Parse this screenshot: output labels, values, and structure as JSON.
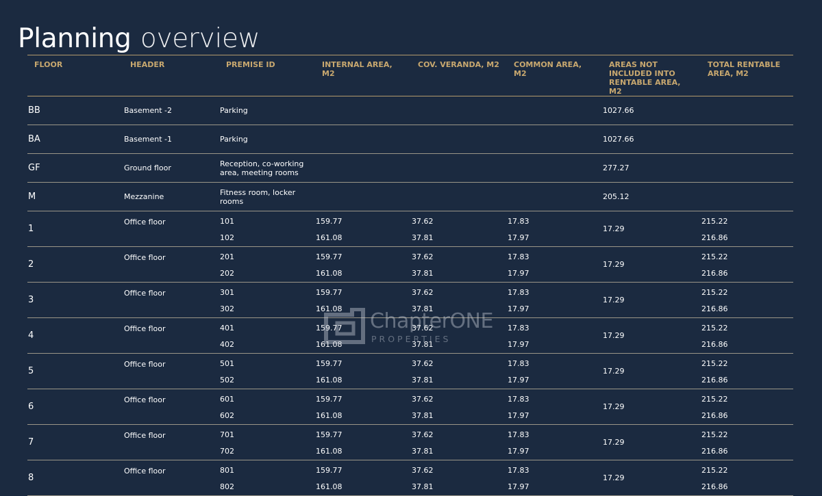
{
  "page": {
    "title_part1": "Planning",
    "title_part2": "overview"
  },
  "table": {
    "headers": [
      "FLOOR",
      "HEADER",
      "PREMISE ID",
      "INTERNAL AREA, m2",
      "COV. VERANDA, m2",
      "COMMON AREA, m2",
      "AREAS NOT INCLUDED INTO RENTABLE AREA, m2",
      "TOTAL RENTABLE AREA, m2"
    ],
    "single_rows": [
      {
        "floor": "BB",
        "header": "Basement -2",
        "premise": "Parking",
        "not_included": "1027.66"
      },
      {
        "floor": "BA",
        "header": "Basement -1",
        "premise": "Parking",
        "not_included": "1027.66"
      },
      {
        "floor": "GF",
        "header": "Ground floor",
        "premise": "Reception, co-working area, meeting rooms",
        "not_included": "277.27"
      },
      {
        "floor": "M",
        "header": "Mezzanine",
        "premise": "Fitness room, locker rooms",
        "not_included": "205.12"
      }
    ],
    "office_rows": [
      {
        "floor": "1",
        "header": "Office floor",
        "ids": [
          "101",
          "102"
        ],
        "internal": [
          "159.77",
          "161.08"
        ],
        "veranda": [
          "37.62",
          "37.81"
        ],
        "common": [
          "17.83",
          "17.97"
        ],
        "not_included": "17.29",
        "total": [
          "215.22",
          "216.86"
        ]
      },
      {
        "floor": "2",
        "header": "Office floor",
        "ids": [
          "201",
          "202"
        ],
        "internal": [
          "159.77",
          "161.08"
        ],
        "veranda": [
          "37.62",
          "37.81"
        ],
        "common": [
          "17.83",
          "17.97"
        ],
        "not_included": "17.29",
        "total": [
          "215.22",
          "216.86"
        ]
      },
      {
        "floor": "3",
        "header": "Office floor",
        "ids": [
          "301",
          "302"
        ],
        "internal": [
          "159.77",
          "161.08"
        ],
        "veranda": [
          "37.62",
          "37.81"
        ],
        "common": [
          "17.83",
          "17.97"
        ],
        "not_included": "17.29",
        "total": [
          "215.22",
          "216.86"
        ]
      },
      {
        "floor": "4",
        "header": "Office floor",
        "ids": [
          "401",
          "402"
        ],
        "internal": [
          "159.77",
          "161.08"
        ],
        "veranda": [
          "37.62",
          "37.81"
        ],
        "common": [
          "17.83",
          "17.97"
        ],
        "not_included": "17.29",
        "total": [
          "215.22",
          "216.86"
        ]
      },
      {
        "floor": "5",
        "header": "Office floor",
        "ids": [
          "501",
          "502"
        ],
        "internal": [
          "159.77",
          "161.08"
        ],
        "veranda": [
          "37.62",
          "37.81"
        ],
        "common": [
          "17.83",
          "17.97"
        ],
        "not_included": "17.29",
        "total": [
          "215.22",
          "216.86"
        ]
      },
      {
        "floor": "6",
        "header": "Office floor",
        "ids": [
          "601",
          "602"
        ],
        "internal": [
          "159.77",
          "161.08"
        ],
        "veranda": [
          "37.62",
          "37.81"
        ],
        "common": [
          "17.83",
          "17.97"
        ],
        "not_included": "17.29",
        "total": [
          "215.22",
          "216.86"
        ]
      },
      {
        "floor": "7",
        "header": "Office floor",
        "ids": [
          "701",
          "702"
        ],
        "internal": [
          "159.77",
          "161.08"
        ],
        "veranda": [
          "37.62",
          "37.81"
        ],
        "common": [
          "17.83",
          "17.97"
        ],
        "not_included": "17.29",
        "total": [
          "215.22",
          "216.86"
        ]
      },
      {
        "floor": "8",
        "header": "Office floor",
        "ids": [
          "801",
          "802"
        ],
        "internal": [
          "159.77",
          "161.08"
        ],
        "veranda": [
          "37.62",
          "37.81"
        ],
        "common": [
          "17.83",
          "17.97"
        ],
        "not_included": "17.29",
        "total": [
          "215.22",
          "216.86"
        ]
      }
    ]
  },
  "watermark": {
    "name": "ChapterONE",
    "sub": "PROPERTIES"
  },
  "colors": {
    "background": "#1b2a40",
    "header_text": "#c8a86f",
    "rule": "#b39a6c"
  }
}
